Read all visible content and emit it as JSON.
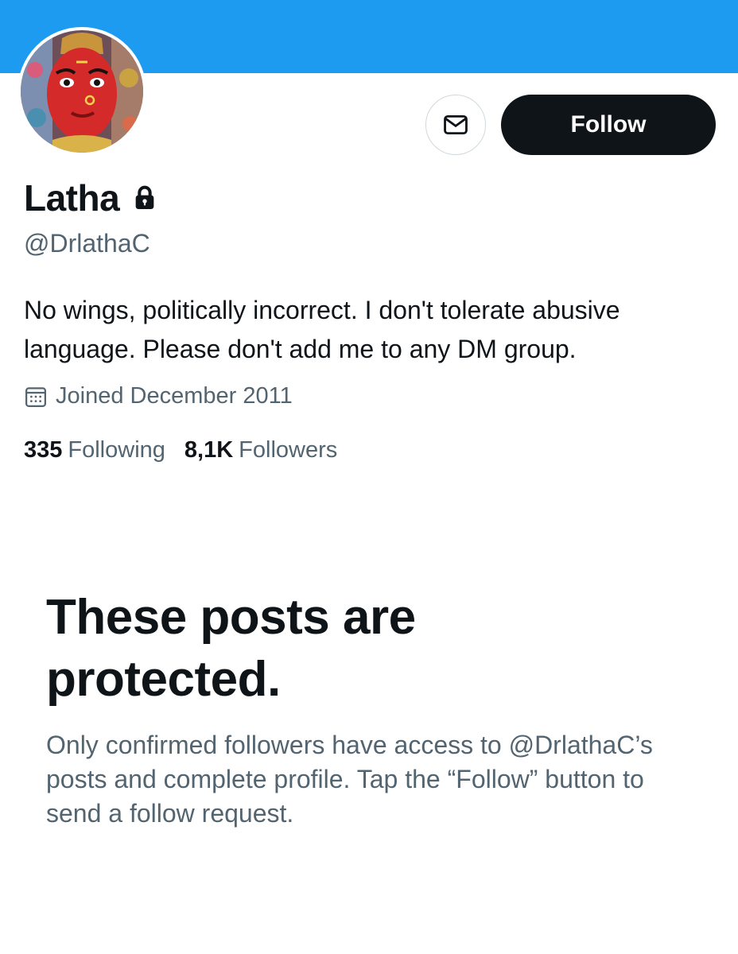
{
  "colors": {
    "banner": "#1d9bf0",
    "follow_button_bg": "#0f1419",
    "text_primary": "#0f1419",
    "text_secondary": "#536471",
    "border": "#cfd9de"
  },
  "profile": {
    "name": "Latha",
    "handle": "@DrlathaC",
    "bio": "No wings, politically incorrect. I don't tolerate abusive language. Please don't add me to any DM group.",
    "joined": "Joined December 2011",
    "locked_icon": "lock-icon",
    "avatar_icon": "avatar-image"
  },
  "actions": {
    "message_icon": "mail-icon",
    "follow_label": "Follow"
  },
  "stats": {
    "following_count": "335",
    "following_label": "Following",
    "followers_count": "8,1K",
    "followers_label": "Followers"
  },
  "protected": {
    "title": "These posts are protected.",
    "description": "Only confirmed followers have access to @DrlathaC’s posts and complete profile. Tap the “Follow” button to send a follow request."
  }
}
